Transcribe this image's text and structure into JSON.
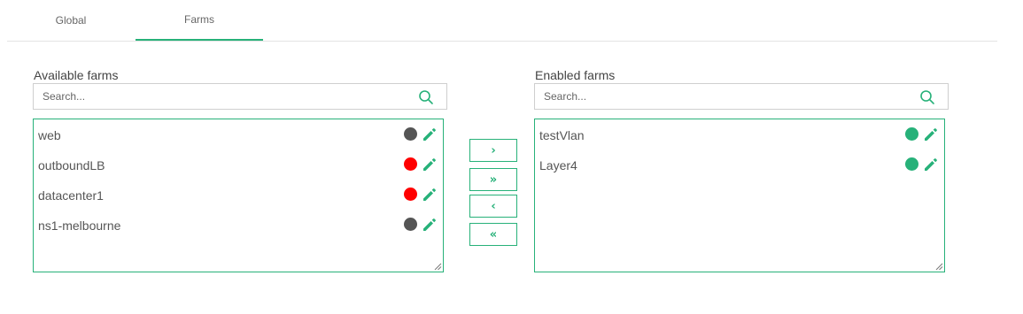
{
  "tabs": [
    {
      "label": "Global",
      "active": false
    },
    {
      "label": "Farms",
      "active": true
    }
  ],
  "accent_color": "#27b179",
  "available": {
    "title": "Available farms",
    "search_placeholder": "Search...",
    "items": [
      {
        "label": "web",
        "status": "grey"
      },
      {
        "label": "outboundLB",
        "status": "red"
      },
      {
        "label": "datacenter1",
        "status": "red"
      },
      {
        "label": "ns1-melbourne",
        "status": "grey"
      }
    ]
  },
  "enabled": {
    "title": "Enabled farms",
    "search_placeholder": "Search...",
    "items": [
      {
        "label": "testVlan",
        "status": "green"
      },
      {
        "label": "Layer4",
        "status": "green"
      }
    ]
  },
  "status_colors": {
    "grey": "#555555",
    "red": "#ff0000",
    "green": "#27b179"
  },
  "buttons": {
    "move_selected_right": "›",
    "move_all_right": "»",
    "move_selected_left": "‹",
    "move_all_left": "«"
  }
}
